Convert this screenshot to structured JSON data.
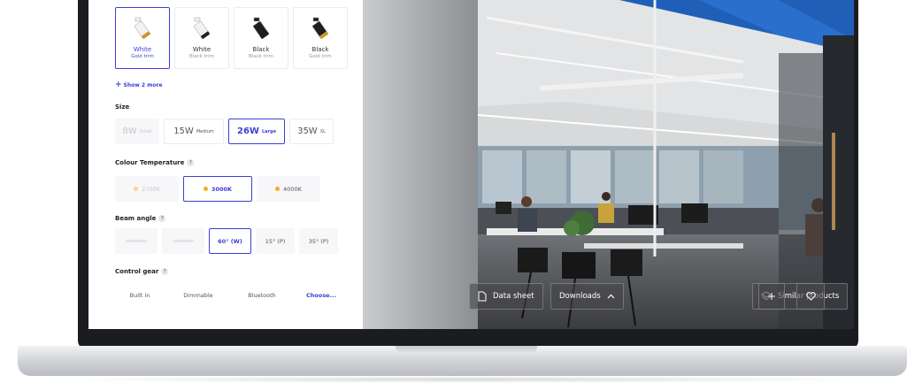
{
  "finish": {
    "options": [
      {
        "name": "White",
        "trim": "Gold trim",
        "selected": true,
        "body": "#f2f2f2",
        "accent": "#c59a2a"
      },
      {
        "name": "White",
        "trim": "Black trim",
        "selected": false,
        "body": "#f2f2f2",
        "accent": "#222222"
      },
      {
        "name": "Black",
        "trim": "Black trim",
        "selected": false,
        "body": "#1e1e1e",
        "accent": "#1e1e1e"
      },
      {
        "name": "Black",
        "trim": "Gold trim",
        "selected": false,
        "body": "#1e1e1e",
        "accent": "#c59a2a"
      }
    ],
    "show_more": "Show 2 more"
  },
  "size": {
    "label": "Size",
    "options": [
      {
        "watt": "8W",
        "name": "Small",
        "state": "disabled"
      },
      {
        "watt": "15W",
        "name": "Medium",
        "state": "normal"
      },
      {
        "watt": "26W",
        "name": "Large",
        "state": "selected"
      },
      {
        "watt": "35W",
        "name": "XL",
        "state": "normal"
      }
    ]
  },
  "colour_temperature": {
    "label": "Colour Temperature",
    "help": "?",
    "options": [
      {
        "label": "2700K",
        "state": "disabled"
      },
      {
        "label": "3000K",
        "state": "selected"
      },
      {
        "label": "4000K",
        "state": "normal"
      }
    ]
  },
  "beam_angle": {
    "label": "Beam angle",
    "help": "?",
    "options": [
      {
        "label": "",
        "state": "disabled"
      },
      {
        "label": "",
        "state": "disabled"
      },
      {
        "label": "60° (W)",
        "state": "selected"
      },
      {
        "label": "15° (P)",
        "state": "normal"
      },
      {
        "label": "35° (P)",
        "state": "normal"
      }
    ]
  },
  "control_gear": {
    "label": "Control gear",
    "help": "?",
    "options": [
      {
        "label": "Built in",
        "state": "normal"
      },
      {
        "label": "Dimmable",
        "state": "normal"
      },
      {
        "label": "Bluetooth",
        "state": "normal"
      },
      {
        "label": "Choose...",
        "state": "link"
      }
    ]
  },
  "photo_actions": {
    "data_sheet": "Data sheet",
    "downloads": "Downloads",
    "similar_products": "Similar products",
    "add": "+",
    "favourite_icon": "heart-icon"
  },
  "colors": {
    "accent": "#3b3fd8",
    "warm_dot": "#f2b21b",
    "ceiling_blue": "#1f5fb8"
  }
}
